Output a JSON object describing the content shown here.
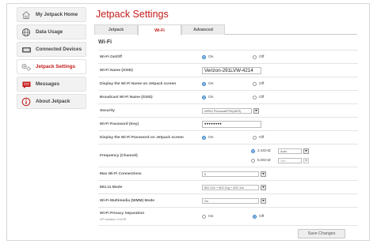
{
  "sidebar": {
    "items": [
      {
        "label": "My Jetpack Home",
        "icon": "home-icon"
      },
      {
        "label": "Data Usage",
        "icon": "globe-icon"
      },
      {
        "label": "Connected Devices",
        "icon": "devices-icon"
      },
      {
        "label": "Jetpack Settings",
        "icon": "gears-icon"
      },
      {
        "label": "Messages",
        "icon": "message-icon"
      },
      {
        "label": "About Jetpack",
        "icon": "info-icon"
      }
    ]
  },
  "page": {
    "title": "Jetpack Settings",
    "tabs": [
      "Jetpack",
      "Wi-Fi",
      "Advanced"
    ],
    "section": "Wi-Fi"
  },
  "settings": {
    "wifi_onoff": {
      "label": "Wi-Fi On/Off",
      "on": "On",
      "off": "Off"
    },
    "ssid": {
      "label": "Wi-Fi Name (SSID)",
      "value": "Verizon-291LVW-4214"
    },
    "display_name": {
      "label": "Display the Wi-Fi Name on Jetpack screen",
      "on": "On",
      "off": "Off"
    },
    "broadcast": {
      "label": "Broadcast Wi-Fi Name (SSID)",
      "on": "On",
      "off": "Off"
    },
    "security": {
      "label": "Security",
      "value": "WPA2 Personal/PSK(AES)"
    },
    "password": {
      "label": "Wi-Fi Password (Key)",
      "value": "••••••••"
    },
    "display_password": {
      "label": "Display the Wi-Fi Password on Jetpack screen",
      "on": "On",
      "off": "Off"
    },
    "frequency": {
      "label": "Frequency (Channel)",
      "band1": "2.4GHZ",
      "band1_channel": "Auto",
      "band2": "5.8GHZ",
      "band2_channel": "149"
    },
    "max_connections": {
      "label": "Max Wi-Fi Connections",
      "value": "5"
    },
    "mode": {
      "label": "802.11 Mode",
      "value": "802.11b + 802.11g + 802.11n"
    },
    "wmm": {
      "label": "Wi-Fi Multimedia (WMM) Mode",
      "value": "On"
    },
    "privacy": {
      "label": "Wi-Fi Privacy Separation",
      "sublabel": "AP isolation On/Off",
      "on": "On",
      "off": "Off"
    }
  },
  "actions": {
    "save": "Save Changes"
  },
  "colors": {
    "accent": "#c41a1a",
    "radio": "#2b7bc4"
  }
}
